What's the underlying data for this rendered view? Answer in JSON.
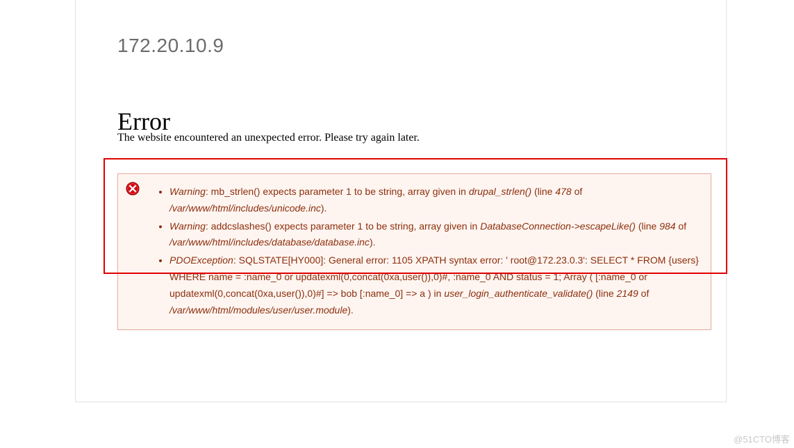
{
  "ip": "172.20.10.9",
  "heading": "Error",
  "subtext": "The website encountered an unexpected error. Please try again later.",
  "messages": [
    {
      "prefix_em": "Warning",
      "sep1": ": mb_strlen() expects parameter 1 to be string, array given in ",
      "func_em": "drupal_strlen()",
      "sep2": " (line ",
      "line_em": "478",
      "sep3": " of ",
      "path_em": "/var/www/html/includes/unicode.inc",
      "sep4": ")."
    },
    {
      "prefix_em": "Warning",
      "sep1": ": addcslashes() expects parameter 1 to be string, array given in ",
      "func_em": "DatabaseConnection->escapeLike()",
      "sep2": " (line ",
      "line_em": "984",
      "sep3": " of ",
      "path_em": "/var/www/html/includes/database/database.inc",
      "sep4": ")."
    },
    {
      "prefix_em": "PDOException",
      "sep1": ": SQLSTATE[HY000]: General error: 1105 XPATH syntax error: ' root@172.23.0.3': SELECT * FROM {users} WHERE name = :name_0 or updatexml(0,concat(0xa,user()),0)#, :name_0 AND status = 1; Array ( [:name_0 or updatexml(0,concat(0xa,user()),0)#] => bob [:name_0] => a ) in ",
      "func_em": "user_login_authenticate_validate()",
      "sep2": " (line ",
      "line_em": "2149",
      "sep3": " of ",
      "path_em": "/var/www/html/modules/user/user.module",
      "sep4": ")."
    }
  ],
  "watermark": "@51CTO博客"
}
